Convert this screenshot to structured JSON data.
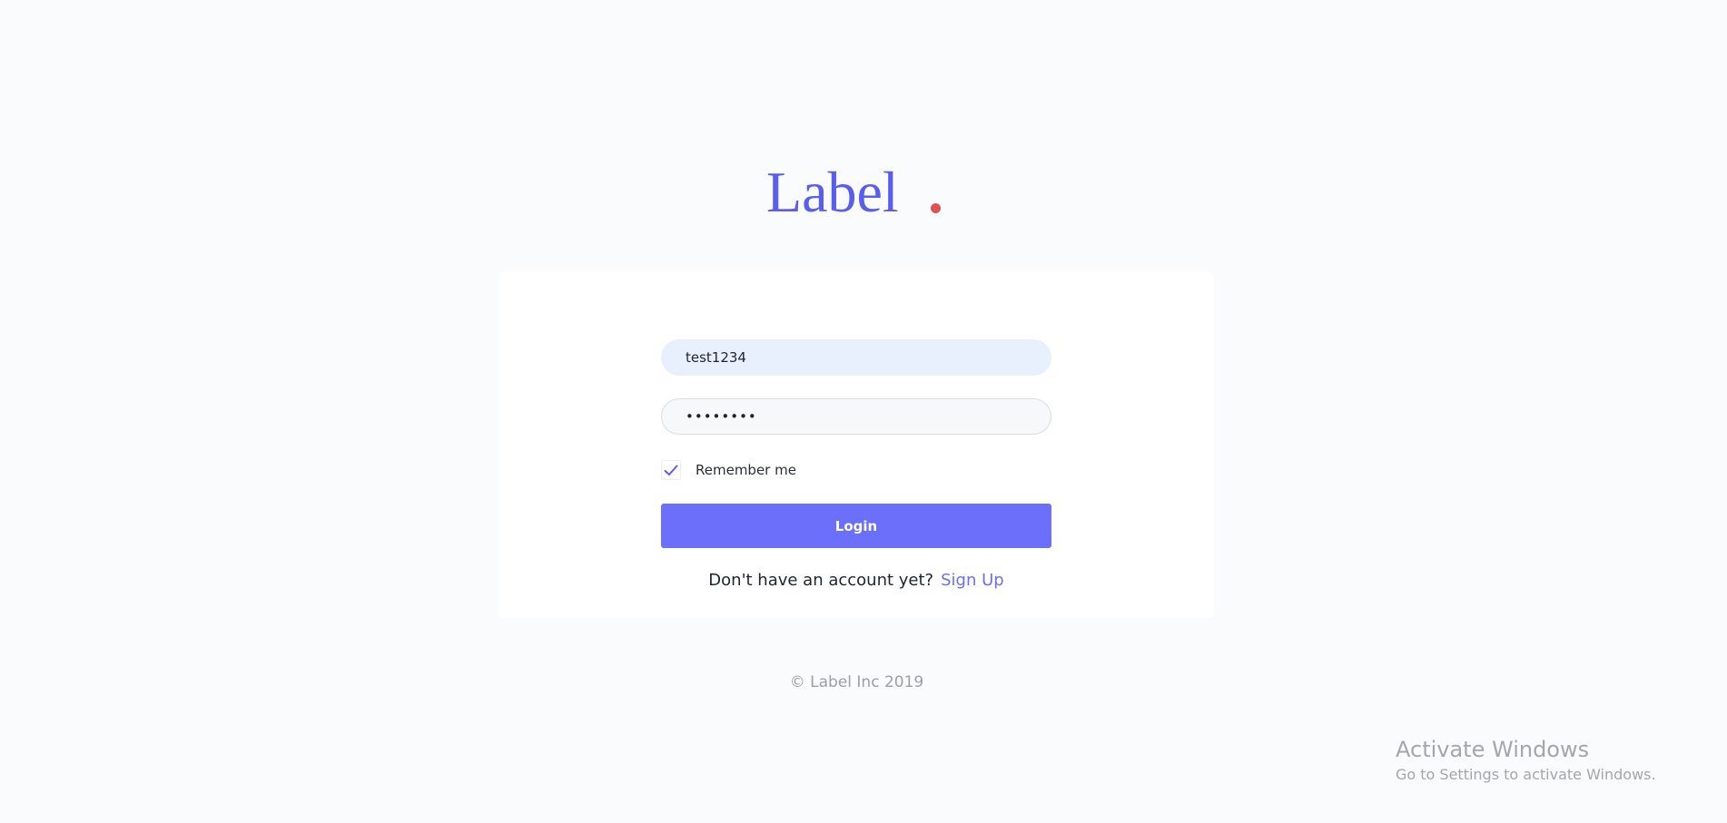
{
  "brand": {
    "name": "Label",
    "dot_color": "#e05252",
    "color": "#5a5ef0"
  },
  "login_form": {
    "username_value": "test1234",
    "password_value": "••••••••",
    "remember_label": "Remember me",
    "remember_checked": true,
    "login_label": "Login",
    "signup_prompt": "Don't have an account yet?",
    "signup_link": "Sign Up",
    "accent_color": "#6b6ff9"
  },
  "footer": {
    "copyright": "© Label Inc 2019"
  },
  "os_watermark": {
    "title": "Activate Windows",
    "subtitle": "Go to Settings to activate Windows."
  }
}
